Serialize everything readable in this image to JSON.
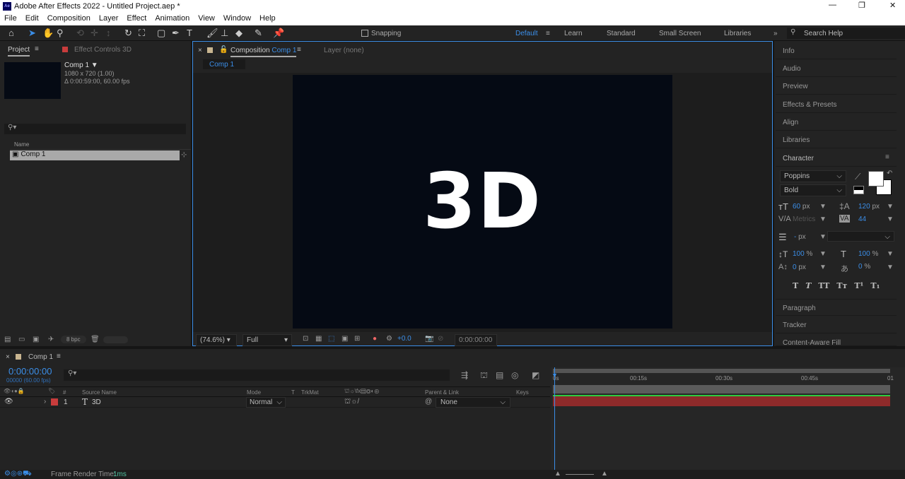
{
  "window": {
    "title": "Adobe After Effects 2022 - Untitled Project.aep *",
    "logo": "Ae"
  },
  "menu": [
    "File",
    "Edit",
    "Composition",
    "Layer",
    "Effect",
    "Animation",
    "View",
    "Window",
    "Help"
  ],
  "toolbar": {
    "snapping": "Snapping",
    "workspaces": [
      "Default",
      "Learn",
      "Standard",
      "Small Screen",
      "Libraries"
    ],
    "search_placeholder": "Search Help"
  },
  "project": {
    "tab": "Project",
    "effect_tab": "Effect Controls 3D",
    "comp_name": "Comp 1 ▼",
    "comp_size": "1080 x 720 (1.00)",
    "comp_duration": "Δ 0:00:59:00, 60.00 fps",
    "col_name": "Name",
    "items": [
      {
        "name": "Comp 1"
      }
    ],
    "bpc": "8 bpc"
  },
  "composition": {
    "tab_prefix": "Composition",
    "tab_name": "Comp 1",
    "layer_tab": "Layer  (none)",
    "breadcrumb": "Comp 1",
    "canvas_text": "3D",
    "zoom": "(74.6%)",
    "resolution": "Full",
    "exposure": "+0.0",
    "timecode": "0:00:00:00",
    "canvas_color": "#050a14"
  },
  "right_panels": {
    "top": [
      "Info",
      "Audio",
      "Preview",
      "Effects & Presets",
      "Align",
      "Libraries",
      "Character"
    ],
    "bottom": [
      "Paragraph",
      "Tracker",
      "Content-Aware Fill"
    ]
  },
  "character": {
    "font": "Poppins",
    "style": "Bold",
    "size": "60",
    "size_unit": "px",
    "leading": "120",
    "leading_unit": "px",
    "kerning": "Metrics",
    "tracking": "44",
    "stroke": "-",
    "stroke_unit": "px",
    "vscale": "100",
    "vscale_unit": "%",
    "hscale": "100",
    "hscale_unit": "%",
    "baseline": "0",
    "baseline_unit": "px",
    "tsume": "0",
    "tsume_unit": "%",
    "styles": [
      "T",
      "T",
      "TT",
      "Tт",
      "T¹",
      "T₁"
    ]
  },
  "timeline": {
    "tab": "Comp 1",
    "timecode": "0:00:00:00",
    "fps": "00000 (60.00 fps)",
    "columns": {
      "num": "#",
      "source": "Source Name",
      "mode": "Mode",
      "t": "T",
      "trkmat": "TrkMat",
      "parent": "Parent & Link",
      "keys": "Keys"
    },
    "layers": [
      {
        "num": "1",
        "name": "3D",
        "mode": "Normal",
        "parent": "None",
        "label_color": "#c83c3c"
      }
    ],
    "ruler": [
      "0s",
      "00:15s",
      "00:30s",
      "00:45s",
      "01"
    ]
  },
  "status": {
    "label": "Frame Render Time:",
    "value": "1ms"
  }
}
